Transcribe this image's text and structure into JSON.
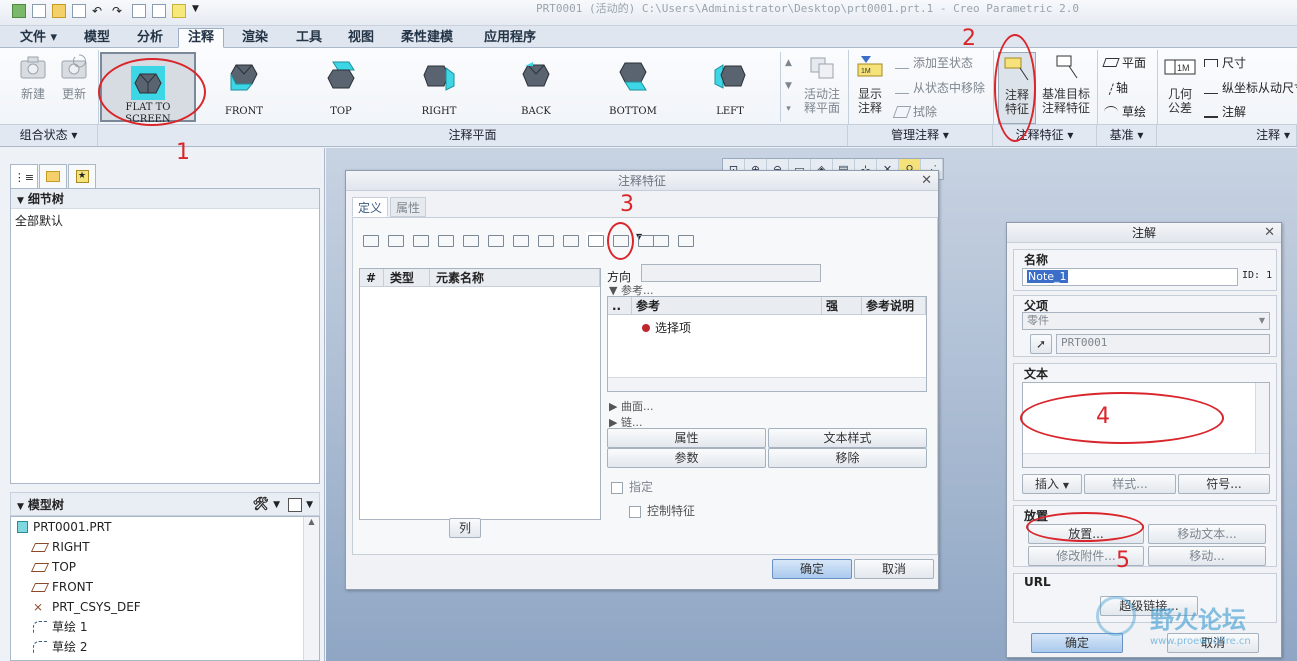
{
  "window": {
    "title": "PRT0001 (活动的) C:\\Users\\Administrator\\Desktop\\prt0001.prt.1 - Creo Parametric 2.0"
  },
  "ribbon_tabs": [
    "文件",
    "模型",
    "分析",
    "注释",
    "渲染",
    "工具",
    "视图",
    "柔性建模",
    "应用程序"
  ],
  "active_tab": "注释",
  "groups": {
    "state": {
      "label": "组合状态",
      "new": "新建",
      "update": "更新"
    },
    "plane": {
      "label": "注释平面",
      "views": [
        {
          "line1": "FLAT  TO",
          "line2": "SCREEN"
        },
        {
          "line1": "FRONT",
          "line2": ""
        },
        {
          "line1": "TOP",
          "line2": ""
        },
        {
          "line1": "RIGHT",
          "line2": ""
        },
        {
          "line1": "BACK",
          "line2": ""
        },
        {
          "line1": "BOTTOM",
          "line2": ""
        },
        {
          "line1": "LEFT",
          "line2": ""
        }
      ],
      "activate_line1": "活动注",
      "activate_line2": "释平面"
    },
    "manage": {
      "label": "管理注释",
      "show_line1": "显示",
      "show_line2": "注释",
      "add_to_state": "添加至状态",
      "remove_from_state": "从状态中移除",
      "erase": "拭除"
    },
    "feature": {
      "label": "注释特征",
      "annot_line1": "注释",
      "annot_line2": "特征",
      "datum_line1": "基准目标",
      "datum_line2": "注释特征"
    },
    "datum": {
      "label": "基准",
      "plane": "平面",
      "axis": "轴",
      "sketch": "草绘"
    },
    "annotation": {
      "label": "注释",
      "geom_line1": "几何",
      "geom_line2": "公差",
      "dimension": "尺寸",
      "ordinate": "纵坐标从动尺寸",
      "note": "注解"
    }
  },
  "left_panel": {
    "detail_tree_title": "细节树",
    "detail_tree_item": "全部默认",
    "model_tree_title": "模型树",
    "model_items": [
      "PRT0001.PRT",
      "RIGHT",
      "TOP",
      "FRONT",
      "PRT_CSYS_DEF",
      "草绘 1",
      "草绘 2"
    ]
  },
  "annotation_feature_dialog": {
    "title": "注释特征",
    "tabs": [
      "定义",
      "属性"
    ],
    "columns": [
      "#",
      "类型",
      "元素名称"
    ],
    "direction_label": "方向",
    "references_label": "参考...",
    "ref_columns": [
      "..",
      "参考",
      "强",
      "参考说明"
    ],
    "select_item": "选择项",
    "surfaces": "曲面...",
    "chains": "链...",
    "btn_properties": "属性",
    "btn_text_style": "文本样式",
    "btn_parameters": "参数",
    "btn_move": "移除",
    "specify": "指定",
    "control_feature": "控制特征",
    "columns_btn": "列",
    "ok": "确定",
    "cancel": "取消"
  },
  "note_dialog": {
    "title": "注解",
    "name_label": "名称",
    "name_value": "Note_1",
    "id_label": "ID: 1",
    "parent_label": "父项",
    "parent_select": "零件",
    "parent_value": "PRT0001",
    "text_label": "文本",
    "insert": "插入",
    "style": "样式...",
    "symbol": "符号...",
    "placement_label": "放置",
    "placement_btn": "放置...",
    "move_text": "移动文本...",
    "modify_attach": "修改附件...",
    "move": "移动...",
    "url_label": "URL",
    "hyperlink": "超级链接...",
    "ok": "确定",
    "cancel": "取消"
  },
  "callouts": [
    "1",
    "2",
    "3",
    "4",
    "5"
  ],
  "watermark": {
    "title": "野火论坛",
    "url": "www.proewildfire.cn"
  },
  "colors": {
    "accent": "#d9262c",
    "ribbon_bg": "#fbfcfe",
    "graphics_top": "#c8d3e2",
    "graphics_bottom": "#8fa6c4",
    "cube_face": "#5a6470",
    "cube_highlight": "#3dd6e6"
  }
}
